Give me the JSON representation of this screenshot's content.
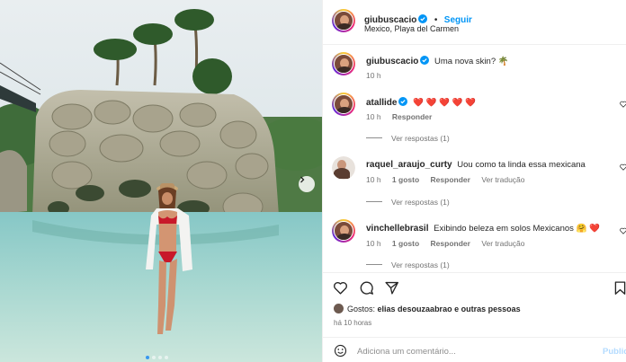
{
  "post": {
    "username": "giubuscacio",
    "follow_label": "Seguir",
    "separator": "•",
    "location": "Mexico, Playa del Carmen",
    "caption_text": "Uma nova skin? 🌴",
    "caption_time": "10 h"
  },
  "comments": [
    {
      "username": "atallide",
      "text": "❤️ ❤️ ❤️ ❤️ ❤️",
      "time": "10 h",
      "likes": "",
      "reply_label": "Responder",
      "translate_label": "",
      "view_replies": "Ver respostas (1)"
    },
    {
      "username": "raquel_araujo_curty",
      "text": "Uou como ta linda essa mexicana",
      "time": "10 h",
      "likes": "1 gosto",
      "reply_label": "Responder",
      "translate_label": "Ver tradução",
      "view_replies": "Ver respostas (1)"
    },
    {
      "username": "vinchellebrasil",
      "text": "Exibindo beleza em solos Mexicanos 🤗 ❤️",
      "time": "10 h",
      "likes": "1 gosto",
      "reply_label": "Responder",
      "translate_label": "Ver tradução",
      "view_replies": "Ver respostas (1)"
    }
  ],
  "likes": {
    "prefix": "Gostos:",
    "user": "elias desouzaabrao",
    "suffix": "e outras pessoas"
  },
  "post_time": "há 10 horas",
  "add_comment": {
    "placeholder": "Adiciona um comentário...",
    "publish_label": "Publica"
  },
  "carousel": {
    "slides": 4,
    "active_slide": 1
  },
  "colors": {
    "accent": "#0095f6",
    "verified": "#0095f6",
    "heart": "#ed1c3a",
    "secondary_text": "#737373"
  },
  "icons": [
    "verified-icon",
    "heart-icon",
    "comment-icon",
    "share-icon",
    "bookmark-icon",
    "emoji-icon",
    "chevron-right-icon"
  ]
}
